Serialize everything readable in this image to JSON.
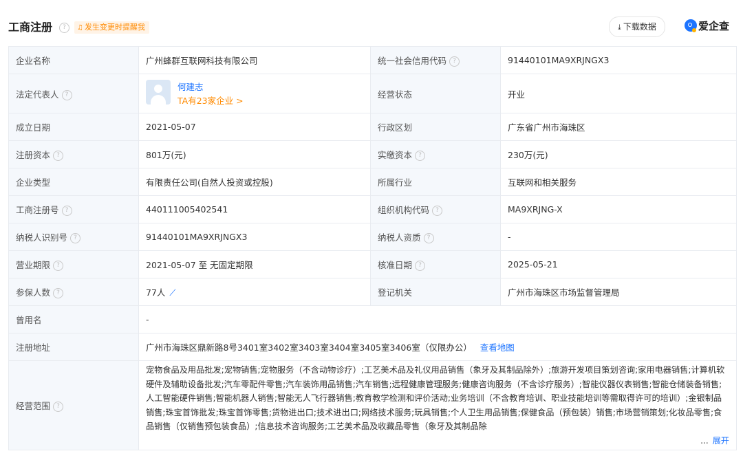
{
  "header": {
    "title": "工商注册",
    "help_glyph": "?",
    "remind_label": "发生变更时提醒我",
    "download_label": "下载数据",
    "brand": "爱企查"
  },
  "rows": [
    {
      "l1": "企业名称",
      "v1": "广州蜂群互联网科技有限公司",
      "l2": "统一社会信用代码",
      "v2": "91440101MA9XRJNGX3"
    },
    {
      "l1": "法定代表人",
      "rep_name": "何建志",
      "rep_count": "TA有23家企业 >",
      "l2": "经营状态",
      "v2": "开业"
    },
    {
      "l1": "成立日期",
      "v1": "2021-05-07",
      "l2": "行政区划",
      "v2": "广东省广州市海珠区"
    },
    {
      "l1": "注册资本",
      "v1": "801万(元)",
      "l2": "实缴资本",
      "v2": "230万(元)"
    },
    {
      "l1": "企业类型",
      "v1": "有限责任公司(自然人投资或控股)",
      "l2": "所属行业",
      "v2": "互联网和相关服务"
    },
    {
      "l1": "工商注册号",
      "v1": "440111005402541",
      "l2": "组织机构代码",
      "v2": "MA9XRJNG-X"
    },
    {
      "l1": "纳税人识别号",
      "v1": "91440101MA9XRJNGX3",
      "l2": "纳税人资质",
      "v2": "-"
    },
    {
      "l1": "营业期限",
      "v1": "2021-05-07 至 无固定期限",
      "l2": "核准日期",
      "v2": "2025-05-21"
    },
    {
      "l1": "参保人数",
      "v1": "77人",
      "l2": "登记机关",
      "v2": "广州市海珠区市场监督管理局"
    }
  ],
  "former_name": {
    "label": "曾用名",
    "value": "-"
  },
  "address": {
    "label": "注册地址",
    "value": "广州市海珠区鼎新路8号3401室3402室3403室3404室3405室3406室（仅限办公）",
    "map_link": "查看地图"
  },
  "scope": {
    "label": "经营范围",
    "text": "宠物食品及用品批发;宠物销售;宠物服务（不含动物诊疗）;工艺美术品及礼仪用品销售（象牙及其制品除外）;旅游开发项目策划咨询;家用电器销售;计算机软硬件及辅助设备批发;汽车零配件零售;汽车装饰用品销售;汽车销售;远程健康管理服务;健康咨询服务（不含诊疗服务）;智能仪器仪表销售;智能仓储装备销售;人工智能硬件销售;智能机器人销售;智能无人飞行器销售;教育教学检测和评价活动;业务培训（不含教育培训、职业技能培训等需取得许可的培训）;金银制品销售;珠宝首饰批发;珠宝首饰零售;货物进出口;技术进出口;网络技术服务;玩具销售;个人卫生用品销售;保健食品（预包装）销售;市场营销策划;化妆品零售;食品销售（仅销售预包装食品）;信息技术咨询服务;工艺美术品及收藏品零售（象牙及其制品除",
    "ellipsis": "...",
    "expand": "展开"
  }
}
